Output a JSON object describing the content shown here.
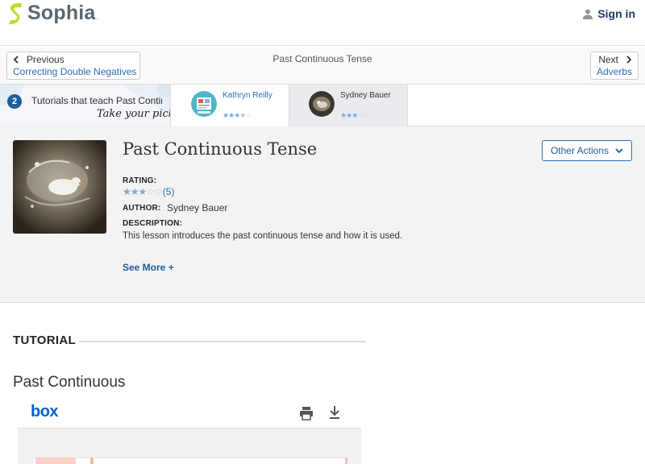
{
  "header": {
    "brand": "Sophia",
    "signin_label": "Sign in"
  },
  "nav": {
    "previous_label": "Previous",
    "previous_title": "Correcting Double Negatives",
    "current_title": "Past Continuous Tense",
    "next_label": "Next",
    "next_title": "Adverbs"
  },
  "picker": {
    "count": "2",
    "text": "Tutorials that teach Past Continuous Tense",
    "handwritten": "Take your pick:",
    "authors": [
      {
        "name": "Kathryn Reilly",
        "stars": 3.5
      },
      {
        "name": "Sydney Bauer",
        "stars": 3
      }
    ]
  },
  "lesson": {
    "title": "Past Continuous Tense",
    "more_actions_label": "Other Actions",
    "rating_label": "RATING:",
    "rating_stars": 3,
    "rating_count": "(5)",
    "author_label": "AUTHOR:",
    "author_name": "Sydney Bauer",
    "description_label": "DESCRIPTION:",
    "description": "This lesson introduces the past continuous tense and how it is used.",
    "see_more_label": "See More +"
  },
  "tutorial": {
    "heading": "TUTORIAL",
    "subheading": "Past Continuous",
    "viewer_brand": "box"
  },
  "colors": {
    "brand_green": "#c6d82f",
    "link_blue": "#2a6fb5",
    "dark_blue": "#1f5c99",
    "box_blue": "#0061d5",
    "star_on": "#7aa7d6"
  },
  "icons": [
    "sophia-logo-icon",
    "user-icon",
    "chevron-left-icon",
    "chevron-right-icon",
    "chevron-down-icon",
    "print-icon",
    "download-icon"
  ]
}
